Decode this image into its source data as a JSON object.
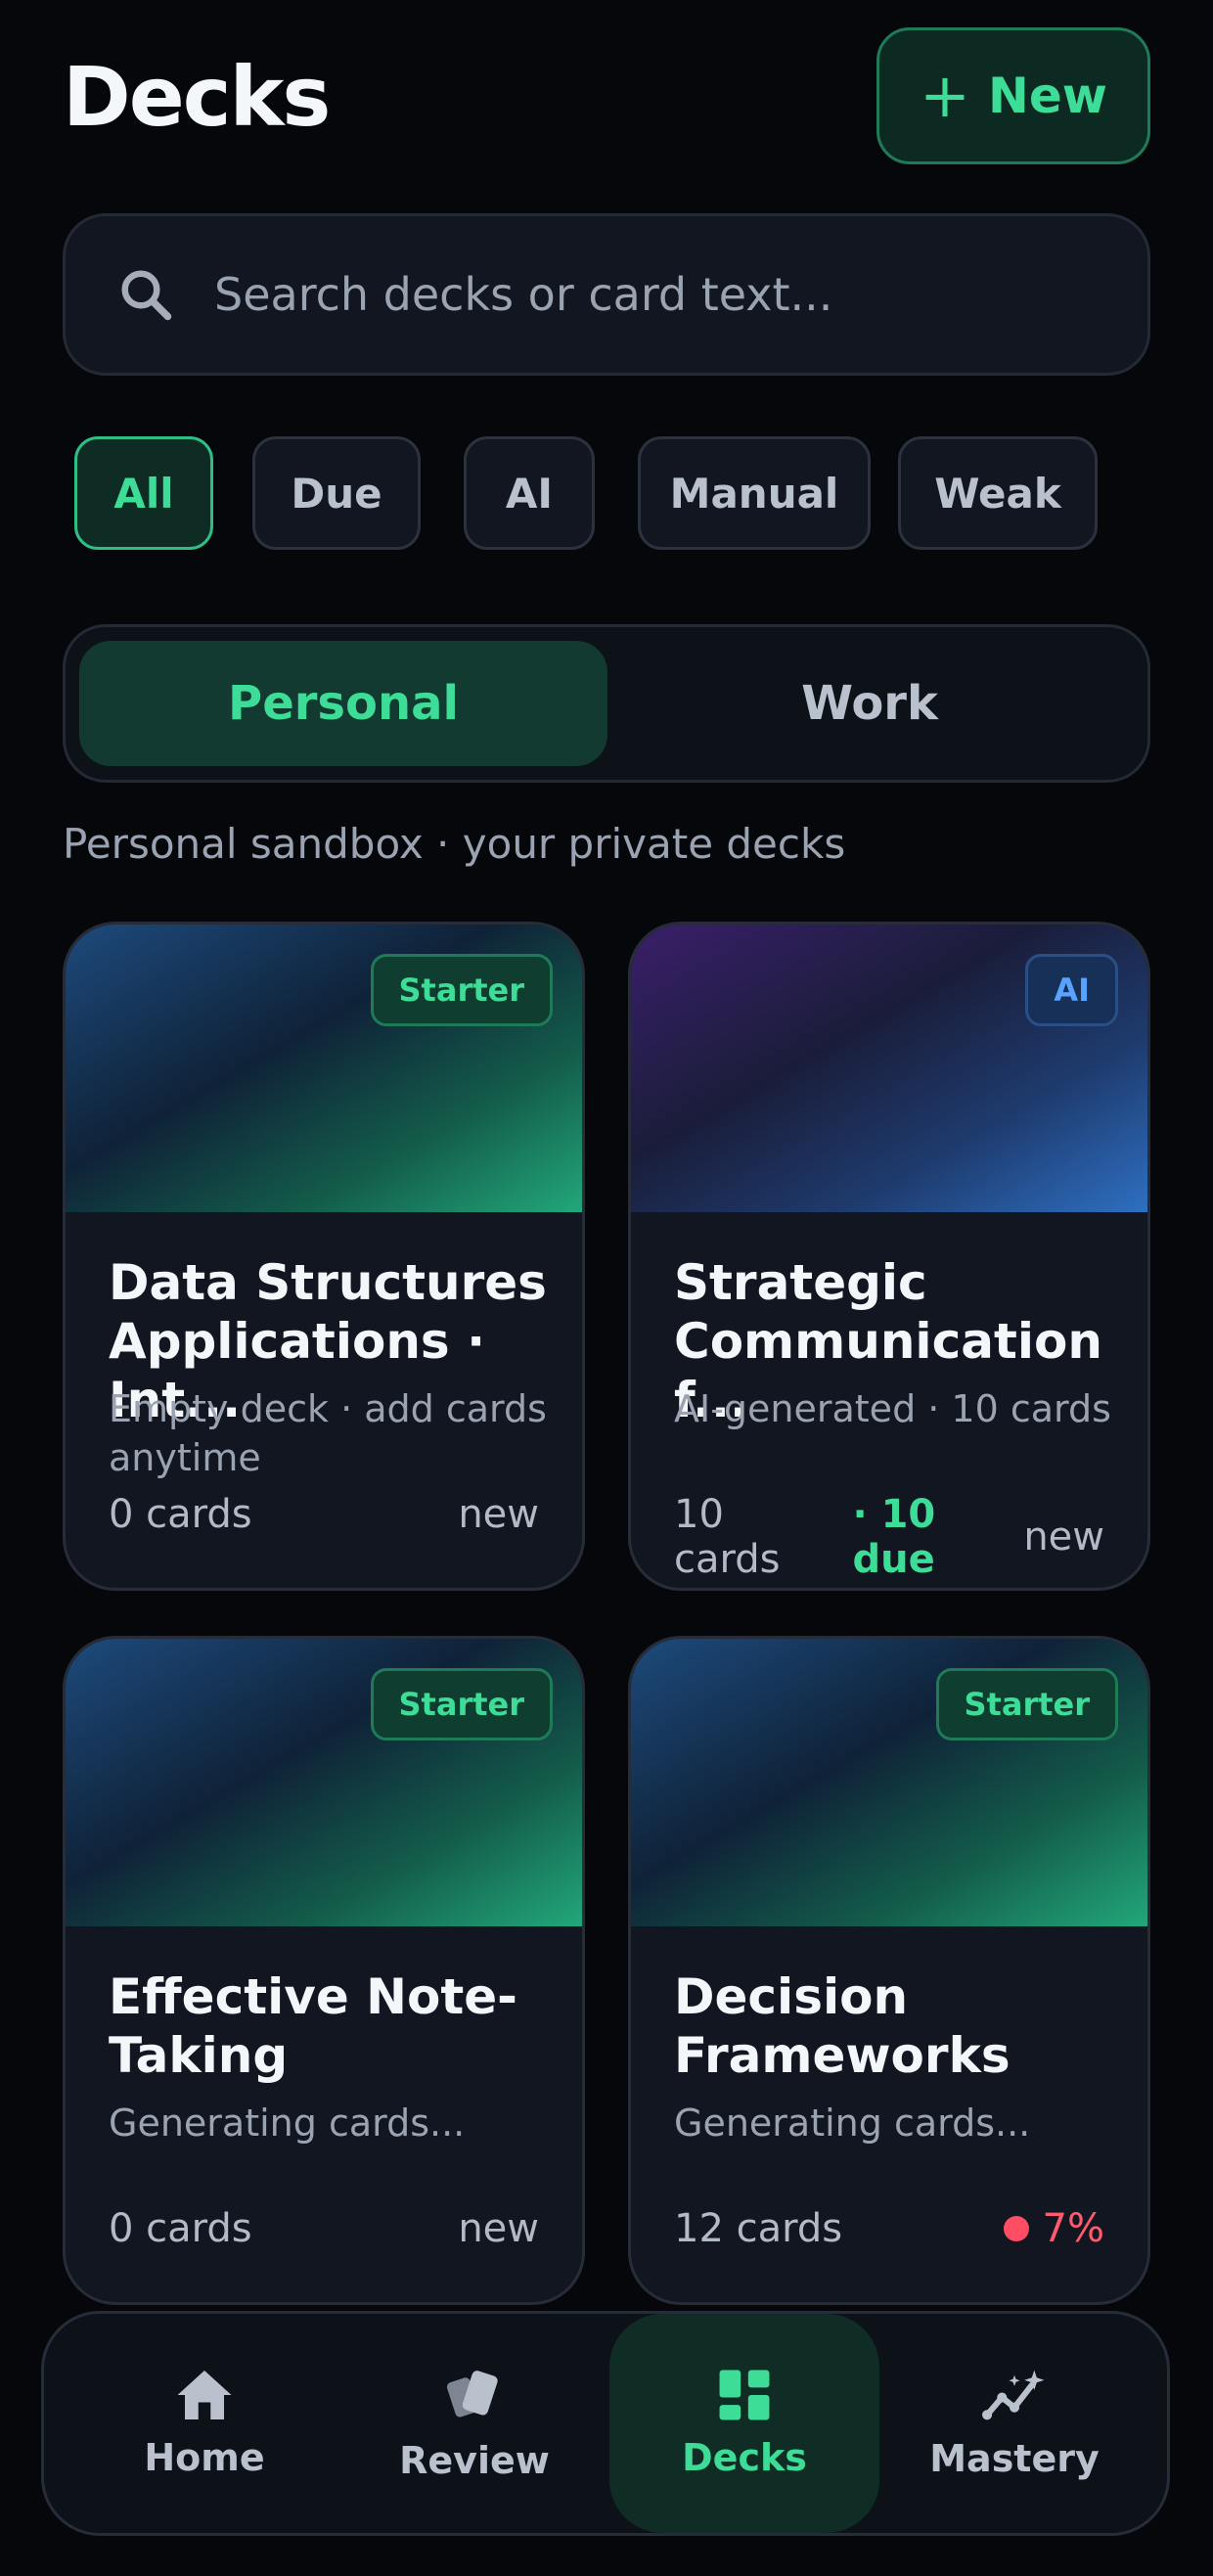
{
  "header": {
    "title": "Decks",
    "new_label": "New"
  },
  "search": {
    "placeholder": "Search decks or card text..."
  },
  "filters": [
    {
      "label": "All",
      "active": true
    },
    {
      "label": "Due",
      "active": false
    },
    {
      "label": "AI",
      "active": false
    },
    {
      "label": "Manual",
      "active": false
    },
    {
      "label": "Weak",
      "active": false
    }
  ],
  "segment": {
    "personal": "Personal",
    "work": "Work",
    "selected": "Personal"
  },
  "subtitle": "Personal sandbox · your private decks",
  "decks": [
    {
      "badge": "Starter",
      "title": "Data Structures\nApplications · Int...",
      "description": "Empty deck · add cards anytime",
      "cards": "0 cards",
      "status": "new"
    },
    {
      "badge": "AI",
      "title": "Strategic\nCommunication f...",
      "description": "AI-generated · 10 cards",
      "cards": "10 cards",
      "due": "· 10 due",
      "status": "new"
    },
    {
      "badge": "Starter",
      "title": "Effective Note-\nTaking",
      "description": "Generating cards...",
      "cards": "0 cards",
      "status": "new"
    },
    {
      "badge": "Starter",
      "title": "Decision\nFrameworks",
      "description": "Generating cards...",
      "cards": "12 cards",
      "mastery": "7%"
    }
  ],
  "tabbar": {
    "items": [
      {
        "label": "Home",
        "icon": "home-icon"
      },
      {
        "label": "Review",
        "icon": "cards-icon"
      },
      {
        "label": "Decks",
        "icon": "grid-icon",
        "active": true
      },
      {
        "label": "Mastery",
        "icon": "sparkline-icon"
      }
    ]
  },
  "colors": {
    "accent": "#3ddc97",
    "background": "#05070b",
    "surface": "#121620",
    "ai_accent": "#5aa2ff",
    "danger": "#ff5a6e"
  }
}
